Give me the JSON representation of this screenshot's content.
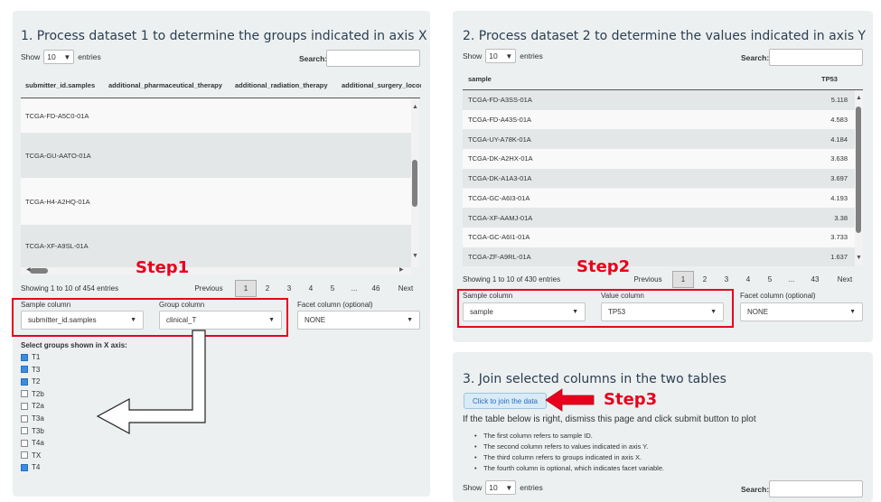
{
  "panel1": {
    "title": "1. Process dataset 1 to determine the groups indicated in axis X",
    "show_label": "Show",
    "entries_label": "entries",
    "length_value": "10",
    "search_label": "Search:",
    "columns": [
      "submitter_id.samples",
      "additional_pharmaceutical_therapy",
      "additional_radiation_therapy",
      "additional_surgery_locore"
    ],
    "rows": [
      "TCGA-FD-A5C0-01A",
      "TCGA-GU-AATO-01A",
      "TCGA-H4-A2HQ-01A",
      "TCGA-XF-A9SL-01A"
    ],
    "info": "Showing 1 to 10 of 454 entries",
    "pager": {
      "previous": "Previous",
      "pages": [
        "1",
        "2",
        "3",
        "4",
        "5",
        "...",
        "46"
      ],
      "next": "Next",
      "current": "1"
    },
    "sample_column_label": "Sample column",
    "sample_column_value": "submitter_id.samples",
    "group_column_label": "Group column",
    "group_column_value": "clinical_T",
    "facet_column_label": "Facet column (optional)",
    "facet_column_value": "NONE",
    "groups_title": "Select groups shown in X axis:",
    "groups": [
      {
        "label": "T1",
        "checked": true
      },
      {
        "label": "T3",
        "checked": true
      },
      {
        "label": "T2",
        "checked": true
      },
      {
        "label": "T2b",
        "checked": false
      },
      {
        "label": "T2a",
        "checked": false
      },
      {
        "label": "T3a",
        "checked": false
      },
      {
        "label": "T3b",
        "checked": false
      },
      {
        "label": "T4a",
        "checked": false
      },
      {
        "label": "TX",
        "checked": false
      },
      {
        "label": "T4",
        "checked": true
      }
    ]
  },
  "panel2": {
    "title": "2. Process dataset 2 to determine the values indicated in axis Y",
    "show_label": "Show",
    "entries_label": "entries",
    "length_value": "10",
    "search_label": "Search:",
    "columns": [
      "sample",
      "TP53"
    ],
    "rows": [
      {
        "sample": "TCGA-FD-A3SS-01A",
        "value": "5.118"
      },
      {
        "sample": "TCGA-FD-A43S-01A",
        "value": "4.583"
      },
      {
        "sample": "TCGA-UY-A78K-01A",
        "value": "4.184"
      },
      {
        "sample": "TCGA-DK-A2HX-01A",
        "value": "3.638"
      },
      {
        "sample": "TCGA-DK-A1A3-01A",
        "value": "3.697"
      },
      {
        "sample": "TCGA-GC-A6I3-01A",
        "value": "4.193"
      },
      {
        "sample": "TCGA-XF-AAMJ-01A",
        "value": "3.38"
      },
      {
        "sample": "TCGA-GC-A6I1-01A",
        "value": "3.733"
      },
      {
        "sample": "TCGA-ZF-A9RL-01A",
        "value": "1.637"
      }
    ],
    "info": "Showing 1 to 10 of 430 entries",
    "pager": {
      "previous": "Previous",
      "pages": [
        "1",
        "2",
        "3",
        "4",
        "5",
        "...",
        "43"
      ],
      "next": "Next",
      "current": "1"
    },
    "sample_column_label": "Sample column",
    "sample_column_value": "sample",
    "value_column_label": "Value column",
    "value_column_value": "TP53",
    "facet_column_label": "Facet column (optional)",
    "facet_column_value": "NONE"
  },
  "panel3": {
    "title": "3. Join selected columns in the two tables",
    "join_button": "Click to join the data",
    "instruction": "If the table below is right, dismiss this page and click submit button to plot",
    "bullets": [
      "The first column refers to sample ID.",
      "The second column refers to values indicated in axis Y.",
      "The third column refers to groups indicated in axis X.",
      "The fourth column is optional, which indicates facet variable."
    ],
    "show_label": "Show",
    "entries_label": "entries",
    "length_value": "10",
    "search_label": "Search:"
  },
  "annotations": {
    "step1": "Step1",
    "step2": "Step2",
    "step3": "Step3",
    "accent_color": "#e8001c",
    "check_color": "#3a8dde"
  }
}
